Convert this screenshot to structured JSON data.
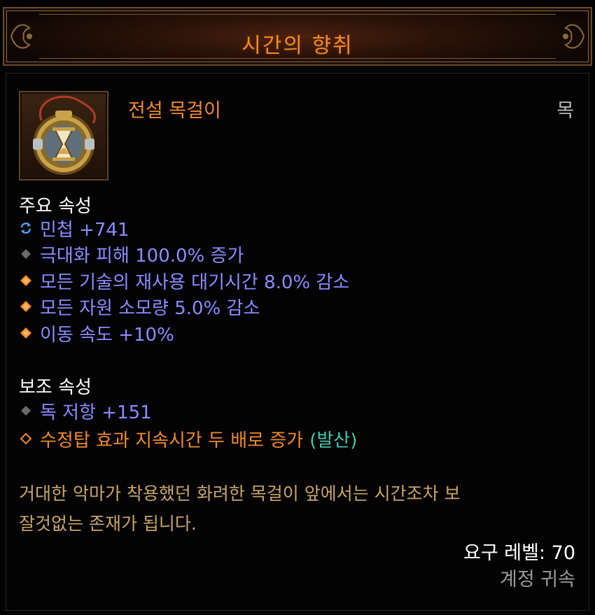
{
  "item": {
    "name": "시간의 향취",
    "type": "전설 목걸이",
    "slot": "목",
    "icon": "hourglass-amulet-icon"
  },
  "primary": {
    "heading": "주요 속성",
    "attributes": [
      {
        "text": "민첩 +741",
        "bullet": "cycle-icon",
        "color": "#8a8cff"
      },
      {
        "text": "극대화 피해 100.0% 증가",
        "bullet": "gray-diamond-icon",
        "color": "#8a8cff"
      },
      {
        "text": "모든 기술의 재사용 대기시간 8.0% 감소",
        "bullet": "orange-diamond-icon",
        "color": "#8a8cff"
      },
      {
        "text": "모든 자원 소모량 5.0% 감소",
        "bullet": "orange-diamond-icon",
        "color": "#8a8cff"
      },
      {
        "text": "이동 속도 +10%",
        "bullet": "orange-diamond-icon",
        "color": "#8a8cff"
      }
    ]
  },
  "secondary": {
    "heading": "보조 속성",
    "attributes": [
      {
        "text": "독 저항 +151",
        "bullet": "gray-diamond-icon",
        "color": "#8a8cff"
      },
      {
        "text": "수정탑 효과 지속시간 두 배로 증가",
        "suffix": "(발산)",
        "bullet": "orange-hollow-diamond-icon",
        "color": "#f08a2a",
        "suffix_color": "#3fc8b0"
      }
    ]
  },
  "flavor": {
    "line1": "거대한 악마가 착용했던 화려한 목걸이 앞에서는 시간조차 보",
    "line2": "잘것없는 존재가 됩니다."
  },
  "footer": {
    "required_level": "요구 레벨: 70",
    "binding": "계정 귀속"
  }
}
